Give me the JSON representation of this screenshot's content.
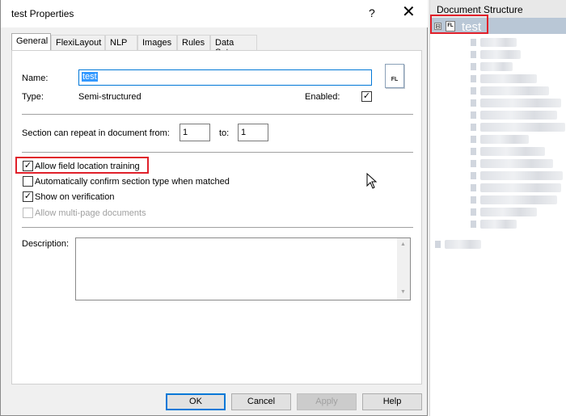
{
  "dialog": {
    "title": "test Properties",
    "help_glyph": "?",
    "close_glyph": "✕",
    "tabs": [
      {
        "label": "General",
        "active": true
      },
      {
        "label": "FlexiLayout"
      },
      {
        "label": "NLP"
      },
      {
        "label": "Images"
      },
      {
        "label": "Rules"
      },
      {
        "label": "Data Sets"
      }
    ],
    "name_label": "Name:",
    "name_value": "test",
    "type_label": "Type:",
    "type_value": "Semi-structured",
    "enabled_label": "Enabled:",
    "enabled_checked": true,
    "fl_icon_text": "FL",
    "repeat_label": "Section can repeat in document from:",
    "repeat_from": "1",
    "to_label": "to:",
    "repeat_to": "1",
    "options": [
      {
        "label": "Allow field location training",
        "checked": true,
        "disabled": false
      },
      {
        "label": "Automatically confirm section type when matched",
        "checked": false,
        "disabled": false
      },
      {
        "label": "Show on verification",
        "checked": true,
        "disabled": false
      },
      {
        "label": "Allow multi-page documents",
        "checked": false,
        "disabled": true
      }
    ],
    "description_label": "Description:",
    "description_value": "",
    "buttons": {
      "ok": "OK",
      "cancel": "Cancel",
      "apply": "Apply",
      "help": "Help"
    }
  },
  "document_structure": {
    "header": "Document Structure",
    "toggle_glyph": "⊟",
    "selected_icon_text": "FL",
    "selected_item": "test"
  },
  "colors": {
    "highlight": "#e0202a",
    "selection": "#3399ff",
    "tree_selection": "#b9c7d6"
  }
}
